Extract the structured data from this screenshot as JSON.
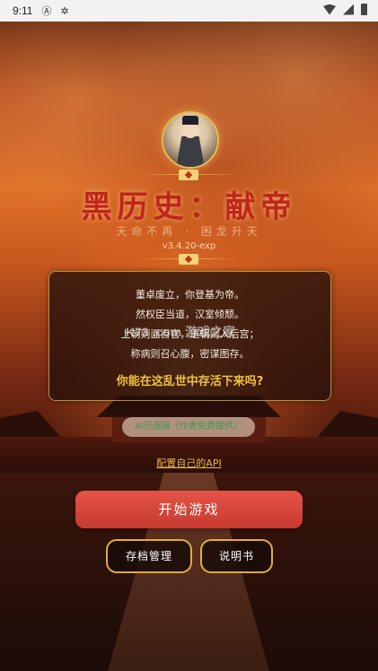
{
  "status_bar": {
    "time": "9:11",
    "icons": [
      "notification-a-icon",
      "bug-icon",
      "wifi-icon",
      "signal-icon",
      "battery-icon"
    ]
  },
  "game": {
    "title": "黑历史：献帝",
    "subtitle": "天命不再 · 困龙升天",
    "version": "v3.4.20-exp"
  },
  "intro": {
    "lines": [
      "董卓废立，你登基为帝。",
      "然权臣当道，汉室倾颓。",
      "上朝则面百官，退朝则入后宫；",
      "称病则召心腹，密谋图存。"
    ],
    "question": "你能在这乱世中存活下来吗?"
  },
  "watermark": "K73 .com 游戏之家",
  "ai_status": "AI已连接（作者免费提供）",
  "api_link": "配置自己的API",
  "buttons": {
    "start": "开始游戏",
    "saves": "存档管理",
    "manual": "说明书"
  },
  "colors": {
    "title": "#c0241c",
    "accent_gold": "#e3ad3f",
    "start_button": "#e04a40",
    "ai_status_text": "#3d9a49",
    "question": "#f2c23b"
  }
}
